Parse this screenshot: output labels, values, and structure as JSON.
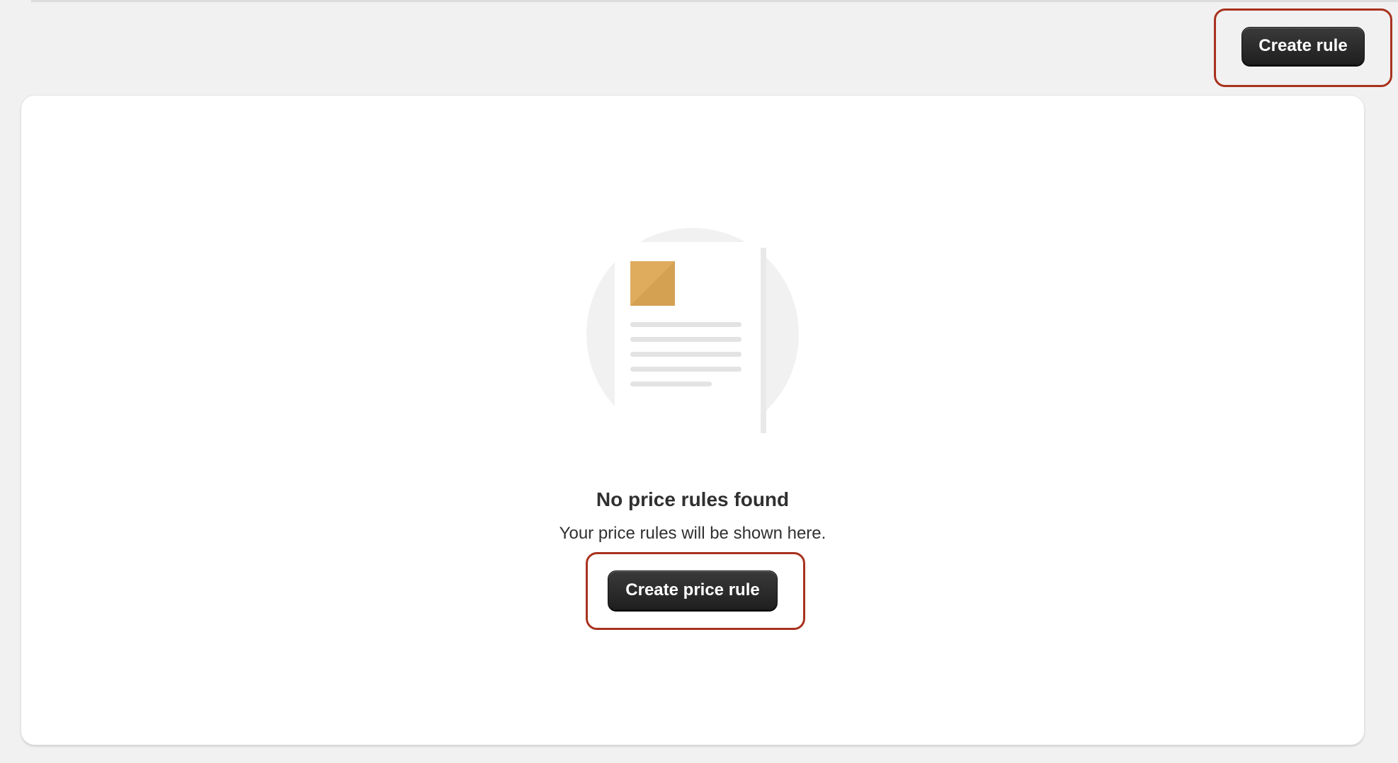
{
  "header": {
    "create_rule_label": "Create rule"
  },
  "empty_state": {
    "illustration_icon": "document-with-image-icon",
    "title": "No price rules found",
    "subtitle": "Your price rules will be shown here.",
    "create_price_rule_label": "Create price rule"
  },
  "colors": {
    "background": "#f1f1f1",
    "card": "#ffffff",
    "button": "#303030",
    "highlight": "#a8321e",
    "illustration_accent": "#dfac5e"
  }
}
